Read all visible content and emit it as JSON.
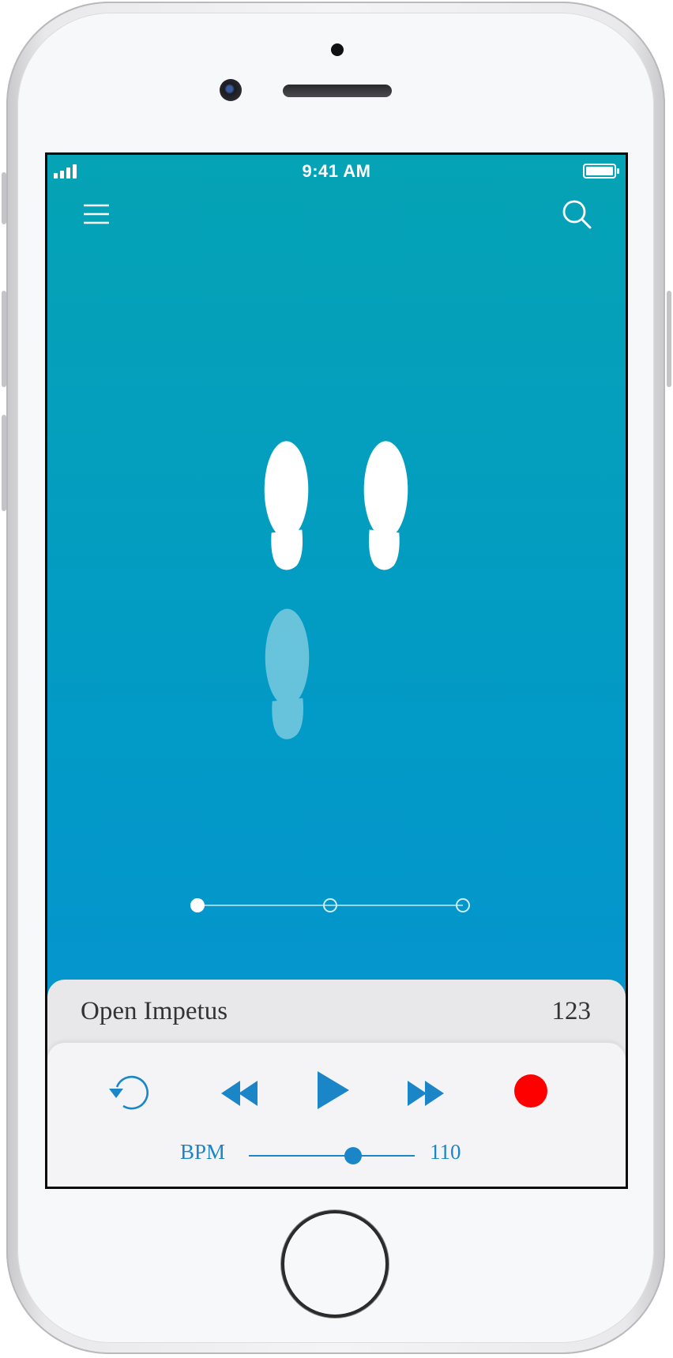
{
  "status_bar": {
    "time": "9:41 AM",
    "battery_level": 1.0,
    "signal_bars": 4
  },
  "nav": {
    "menu_icon": "hamburger-menu-icon",
    "search_icon": "search-icon"
  },
  "steps": {
    "count": 3,
    "current": 1
  },
  "track": {
    "title": "Open Impetus",
    "number": "123"
  },
  "controls": {
    "repeat_icon": "repeat-icon",
    "rewind_icon": "rewind-icon",
    "play_icon": "play-icon",
    "fast_forward_icon": "fast-forward-icon",
    "record_icon": "record-icon"
  },
  "bpm": {
    "label": "BPM",
    "value": "110",
    "slider_fraction": 0.63
  },
  "colors": {
    "accent": "#1a86c8",
    "record": "#ff0000",
    "gradient_top": "#05a3b5",
    "gradient_bottom": "#0592d2"
  }
}
